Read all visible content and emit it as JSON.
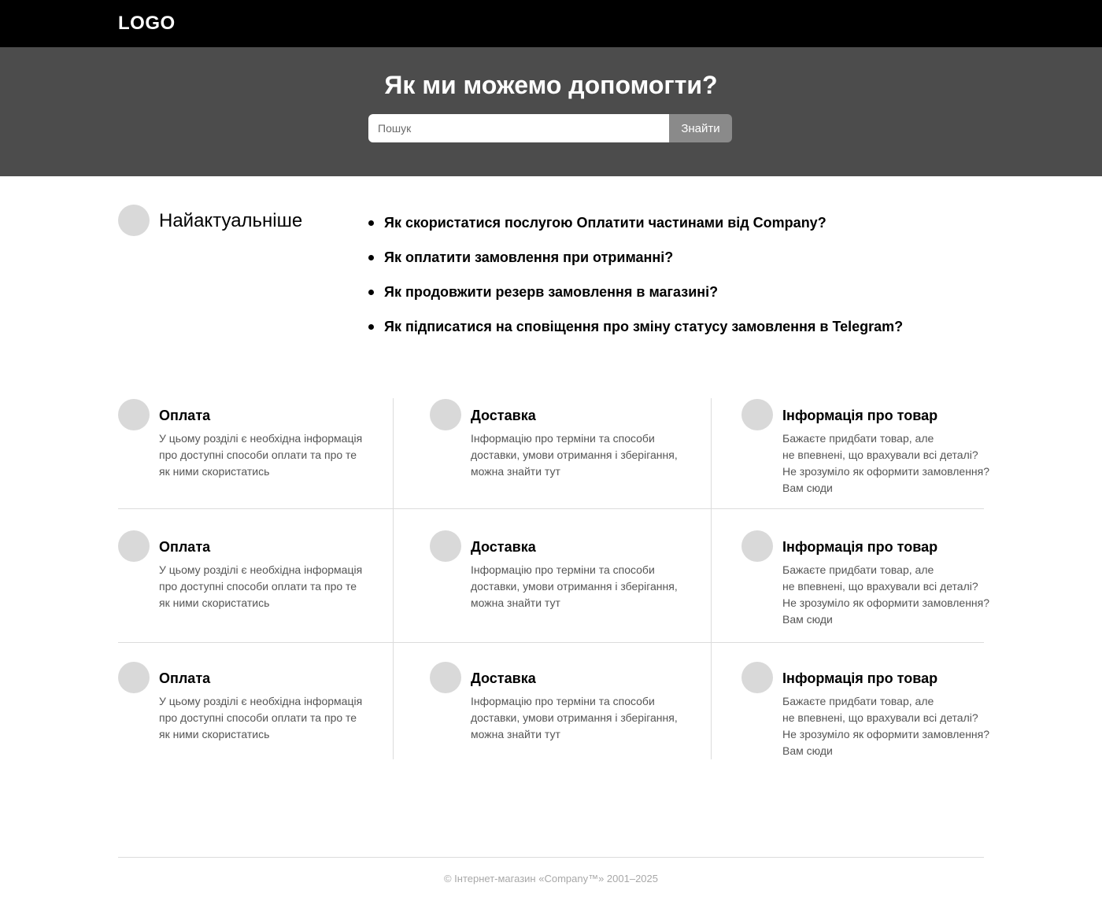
{
  "header": {
    "logo": "LOGO"
  },
  "hero": {
    "title": "Як ми можемо допомогти?",
    "search_placeholder": "Пошук",
    "search_value": "",
    "search_button": "Знайти"
  },
  "top": {
    "title": "Найактуальніше",
    "items": [
      "Як скористатися послугою Оплатити частинами від Company?",
      "Як оплатити замовлення при отриманні?",
      "Як продовжити резерв замовлення в магазині?",
      "Як підписатися на сповіщення про зміну статусу замовлення в Telegram?"
    ]
  },
  "categories": [
    [
      {
        "title": "Оплата",
        "lines": [
          "У цьому розділі є необхідна інформація",
          "про доступні способи оплати та про те",
          "як ними скористатись"
        ]
      },
      {
        "title": "Доставка",
        "lines": [
          "Інформацію про терміни та способи",
          "доставки, умови отримання і зберігання,",
          "можна знайти тут"
        ]
      },
      {
        "title": "Інформація про товар",
        "lines": [
          "Бажаєте придбати товар, але",
          "не впевнені, що врахували всі деталі?",
          "Не зрозуміло як оформити замовлення?",
          "Вам сюди"
        ]
      }
    ],
    [
      {
        "title": "Оплата",
        "lines": [
          "У цьому розділі є необхідна інформація",
          "про доступні способи оплати та про те",
          "як ними скористатись"
        ]
      },
      {
        "title": "Доставка",
        "lines": [
          "Інформацію про терміни та способи",
          "доставки, умови отримання і зберігання,",
          "можна знайти тут"
        ]
      },
      {
        "title": "Інформація про товар",
        "lines": [
          "Бажаєте придбати товар, але",
          "не впевнені, що врахували всі деталі?",
          "Не зрозуміло як оформити замовлення?",
          "Вам сюди"
        ]
      }
    ],
    [
      {
        "title": "Оплата",
        "lines": [
          "У цьому розділі є необхідна інформація",
          "про доступні способи оплати та про те",
          "як ними скористатись"
        ]
      },
      {
        "title": "Доставка",
        "lines": [
          "Інформацію про терміни та способи",
          "доставки, умови отримання і зберігання,",
          "можна знайти тут"
        ]
      },
      {
        "title": "Інформація про товар",
        "lines": [
          "Бажаєте придбати товар, але",
          "не впевнені, що врахували всі деталі?",
          "Не зрозуміло як оформити замовлення?",
          "Вам сюди"
        ]
      }
    ]
  ],
  "footer": {
    "copyright": "© Інтернет-магазин «Company™» 2001–2025"
  }
}
